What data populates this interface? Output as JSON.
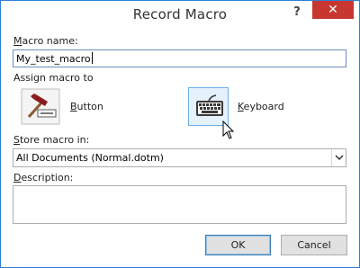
{
  "dialog": {
    "title": "Record Macro",
    "help_label": "?",
    "close_label": "✕"
  },
  "macro_name": {
    "label_mnemonic": "M",
    "label_rest": "acro name:",
    "value": "My_test_macro"
  },
  "assign": {
    "label": "Assign macro to",
    "button": {
      "label_mnemonic": "B",
      "label_rest": "utton",
      "icon": "hammer-button-icon"
    },
    "keyboard": {
      "label_mnemonic": "K",
      "label_rest": "eyboard",
      "icon": "keyboard-icon"
    }
  },
  "store": {
    "label_mnemonic": "S",
    "label_rest": "tore macro in:",
    "selected": "All Documents (Normal.dotm)"
  },
  "description": {
    "label_mnemonic": "D",
    "label_rest": "escription:",
    "value": ""
  },
  "footer": {
    "ok_label": "OK",
    "cancel_label": "Cancel"
  },
  "colors": {
    "accent_border": "#2b7fd4",
    "close_red": "#c7372f",
    "hover_fill": "#e5f1fb"
  }
}
